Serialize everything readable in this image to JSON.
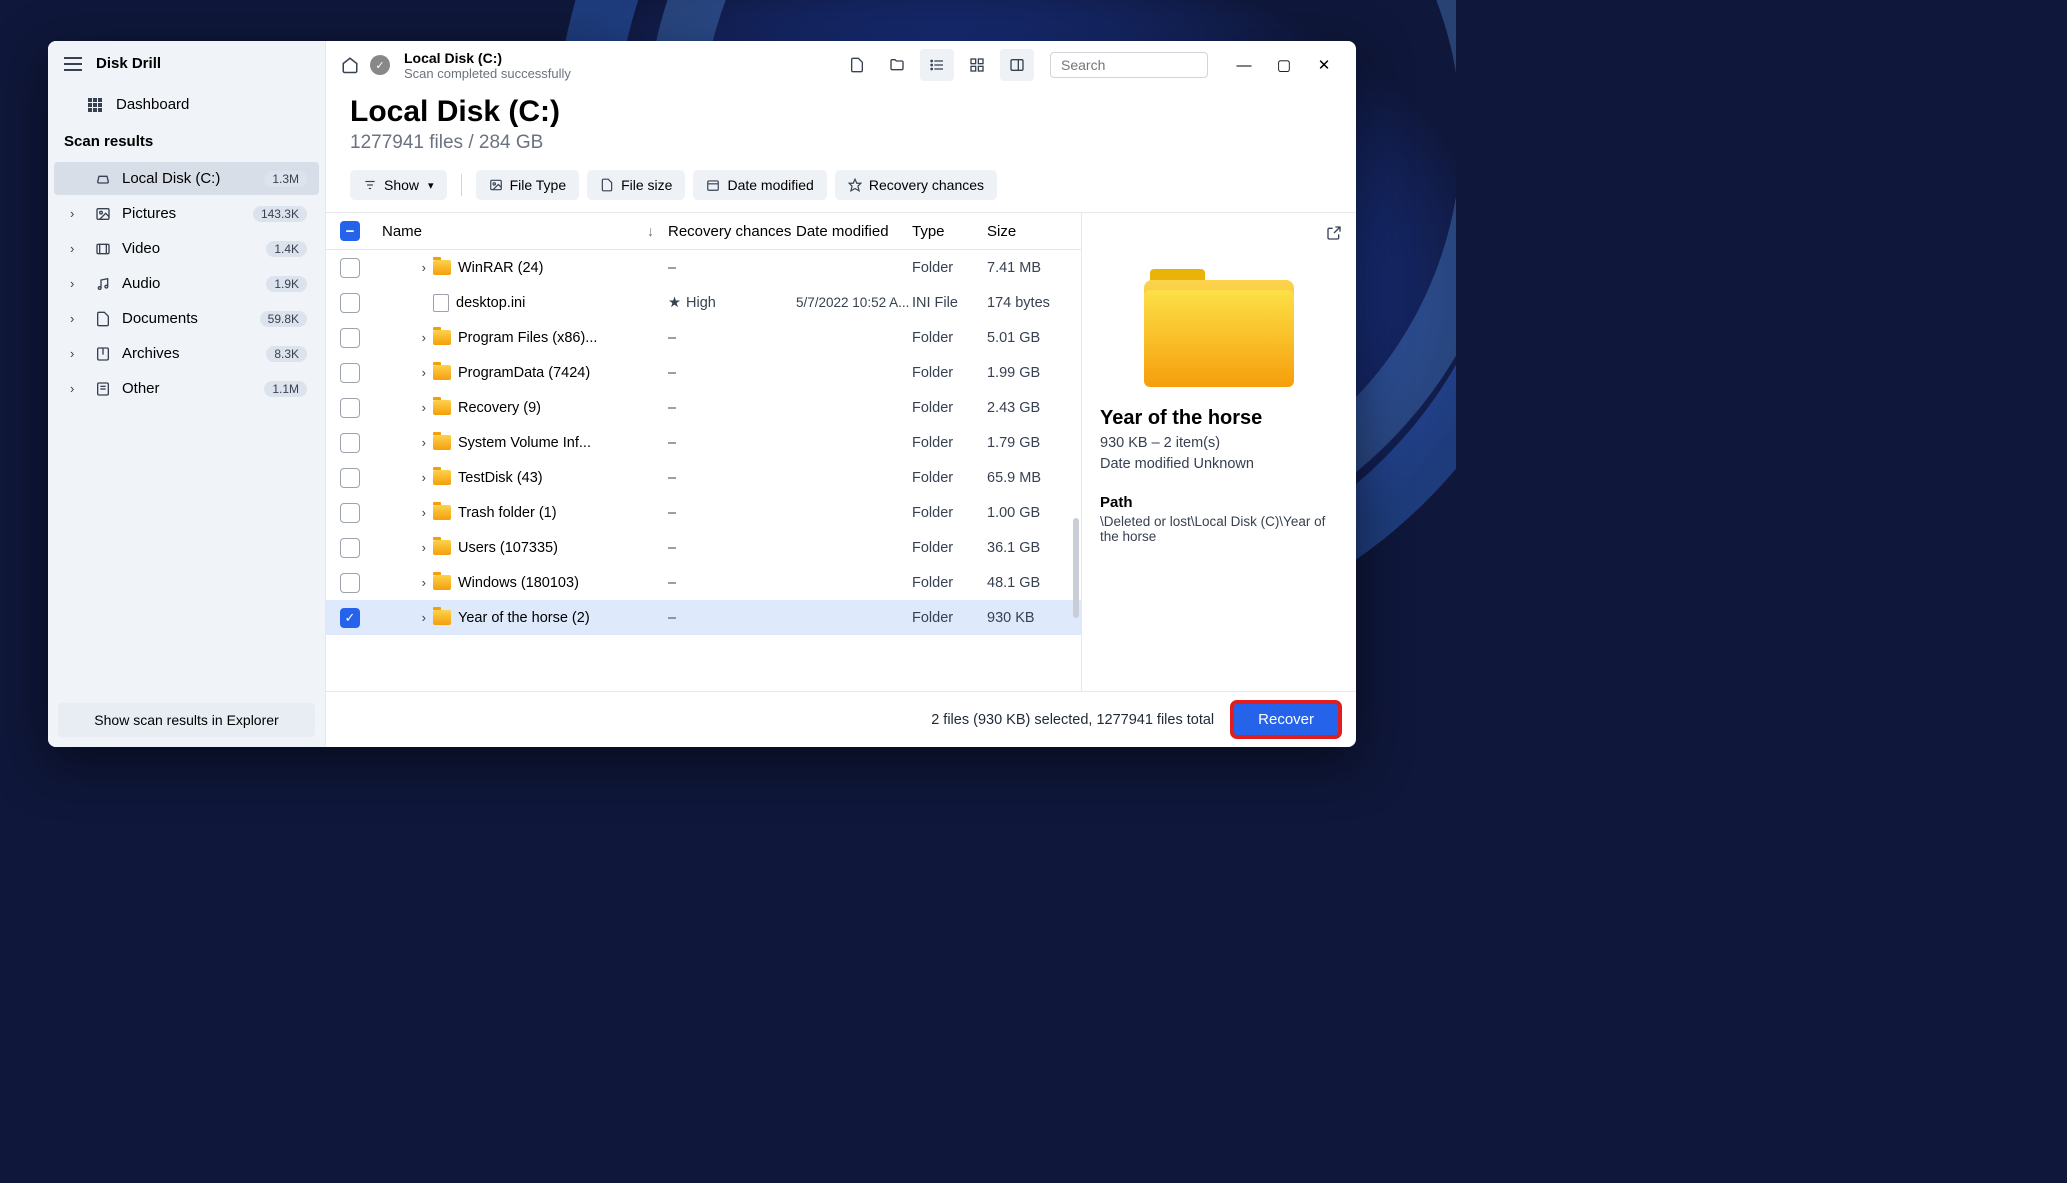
{
  "app": {
    "name": "Disk Drill"
  },
  "sidebar": {
    "dashboard_label": "Dashboard",
    "section_label": "Scan results",
    "items": [
      {
        "label": "Local Disk (C:)",
        "count": "1.3M",
        "icon": "disk",
        "active": true
      },
      {
        "label": "Pictures",
        "count": "143.3K",
        "icon": "image"
      },
      {
        "label": "Video",
        "count": "1.4K",
        "icon": "video"
      },
      {
        "label": "Audio",
        "count": "1.9K",
        "icon": "audio"
      },
      {
        "label": "Documents",
        "count": "59.8K",
        "icon": "document"
      },
      {
        "label": "Archives",
        "count": "8.3K",
        "icon": "archive"
      },
      {
        "label": "Other",
        "count": "1.1M",
        "icon": "other"
      }
    ],
    "show_explorer": "Show scan results in Explorer"
  },
  "breadcrumb": {
    "title": "Local Disk (C:)",
    "subtitle": "Scan completed successfully"
  },
  "search": {
    "placeholder": "Search"
  },
  "header": {
    "title": "Local Disk (C:)",
    "subtitle": "1277941 files / 284 GB"
  },
  "toolbar": {
    "show": "Show",
    "file_type": "File Type",
    "file_size": "File size",
    "date_modified": "Date modified",
    "recovery_chances": "Recovery chances"
  },
  "columns": {
    "name": "Name",
    "recovery": "Recovery chances",
    "date": "Date modified",
    "type": "Type",
    "size": "Size"
  },
  "rows": [
    {
      "name": "WinRAR (24)",
      "recovery": "–",
      "date": "",
      "type": "Folder",
      "size": "7.41 MB",
      "kind": "folder"
    },
    {
      "name": "desktop.ini",
      "recovery": "High",
      "date": "5/7/2022 10:52 A...",
      "type": "INI File",
      "size": "174 bytes",
      "kind": "file",
      "star": true,
      "no_expand": true
    },
    {
      "name": "Program Files (x86)...",
      "recovery": "–",
      "date": "",
      "type": "Folder",
      "size": "5.01 GB",
      "kind": "folder"
    },
    {
      "name": "ProgramData (7424)",
      "recovery": "–",
      "date": "",
      "type": "Folder",
      "size": "1.99 GB",
      "kind": "folder"
    },
    {
      "name": "Recovery (9)",
      "recovery": "–",
      "date": "",
      "type": "Folder",
      "size": "2.43 GB",
      "kind": "folder"
    },
    {
      "name": "System Volume Inf...",
      "recovery": "–",
      "date": "",
      "type": "Folder",
      "size": "1.79 GB",
      "kind": "folder"
    },
    {
      "name": "TestDisk (43)",
      "recovery": "–",
      "date": "",
      "type": "Folder",
      "size": "65.9 MB",
      "kind": "folder"
    },
    {
      "name": "Trash folder (1)",
      "recovery": "–",
      "date": "",
      "type": "Folder",
      "size": "1.00 GB",
      "kind": "folder"
    },
    {
      "name": "Users (107335)",
      "recovery": "–",
      "date": "",
      "type": "Folder",
      "size": "36.1 GB",
      "kind": "folder"
    },
    {
      "name": "Windows (180103)",
      "recovery": "–",
      "date": "",
      "type": "Folder",
      "size": "48.1 GB",
      "kind": "folder"
    },
    {
      "name": "Year of the horse (2)",
      "recovery": "–",
      "date": "",
      "type": "Folder",
      "size": "930 KB",
      "kind": "folder",
      "checked": true,
      "selected": true
    }
  ],
  "info": {
    "title": "Year of the horse",
    "subtitle": "930 KB – 2 item(s)",
    "modified": "Date modified Unknown",
    "path_label": "Path",
    "path": "\\Deleted or lost\\Local Disk (C)\\Year of the horse"
  },
  "footer": {
    "status": "2 files (930 KB) selected, 1277941 files total",
    "recover": "Recover"
  }
}
